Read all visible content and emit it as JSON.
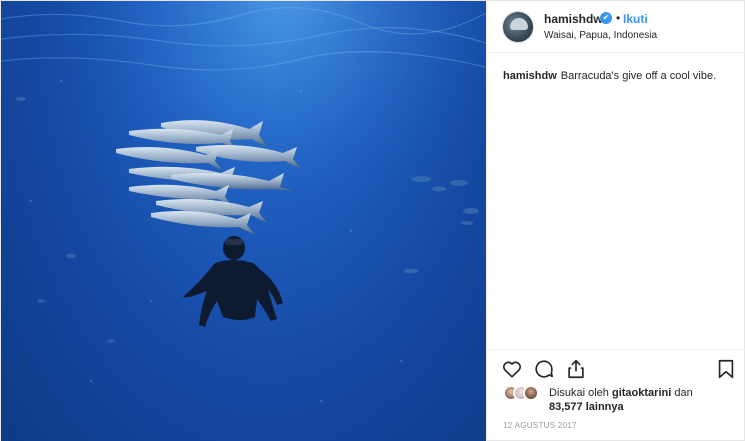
{
  "post": {
    "image_alt": "",
    "header": {
      "username": "hamishdw",
      "verified_icon": "verified-badge-icon",
      "separator": "•",
      "follow_label": "Ikuti",
      "location": "Waisai, Papua, Indonesia"
    },
    "caption": {
      "username": "hamishdw",
      "text": "Barracuda's give off a cool vibe."
    },
    "actions": {
      "like_icon": "heart-icon",
      "comment_icon": "comment-icon",
      "share_icon": "share-icon",
      "save_icon": "bookmark-icon"
    },
    "likes": {
      "prefix": "Disukai oleh",
      "liker": "gitaoktarini",
      "connector": "dan",
      "count": "83,577",
      "suffix": "lainnya"
    },
    "date": "12 AGUSTUS 2017"
  },
  "colors": {
    "link_blue": "#3897f0",
    "text": "#262626",
    "muted": "#999999"
  }
}
